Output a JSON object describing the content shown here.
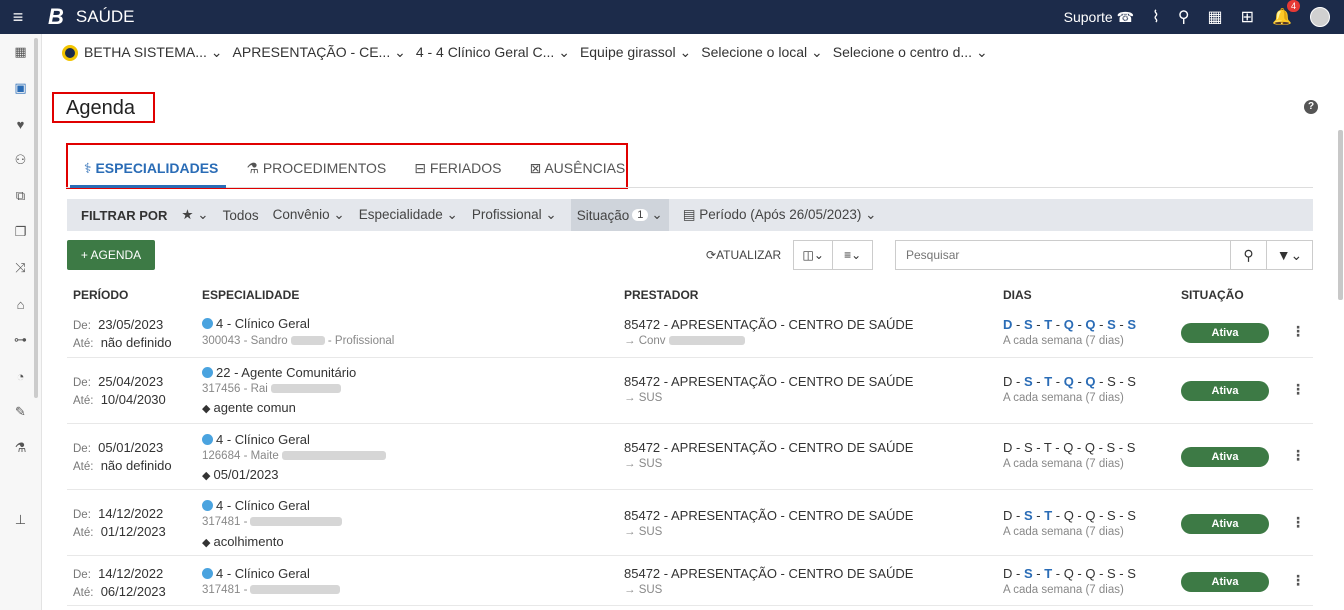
{
  "header": {
    "logo": "B",
    "app_name": "SAÚDE",
    "support_label": "Suporte",
    "notifications_count": "4"
  },
  "breadcrumb": [
    "BETHA SISTEMA... ⌄",
    "APRESENTAÇÃO - CE... ⌄",
    "4 - 4 Clínico Geral C... ⌄",
    "Equipe girassol ⌄",
    "Selecione o local ⌄",
    "Selecione o centro d... ⌄"
  ],
  "page": {
    "title": "Agenda"
  },
  "tabs": [
    {
      "label": "ESPECIALIDADES",
      "icon": "user-md-icon"
    },
    {
      "label": "PROCEDIMENTOS",
      "icon": "flask-icon"
    },
    {
      "label": "FERIADOS",
      "icon": "calendar-minus-icon"
    },
    {
      "label": "AUSÊNCIAS",
      "icon": "calendar-x-icon"
    }
  ],
  "filter": {
    "label": "FILTRAR POR",
    "todos": "Todos",
    "convenio": "Convênio ⌄",
    "especialidade": "Especialidade ⌄",
    "profissional": "Profissional ⌄",
    "situacao": "Situação",
    "situacao_count": "1",
    "periodo": "Período (Após 26/05/2023) ⌄"
  },
  "toolbar": {
    "add_label": "+ AGENDA",
    "refresh_label": "ATUALIZAR",
    "search_placeholder": "Pesquisar"
  },
  "columns": {
    "periodo": "PERÍODO",
    "especialidade": "ESPECIALIDADE",
    "prestador": "PRESTADOR",
    "dias": "DIAS",
    "situacao": "SITUAÇÃO"
  },
  "rows": [
    {
      "de": "23/05/2023",
      "ate": "não definido",
      "esp": "4 - Clínico Geral",
      "prof": "300043 - Sandro",
      "prof_suffix": " - Profissional",
      "tag": "",
      "prest": "85472 - APRESENTAÇÃO - CENTRO DE SAÚDE",
      "prest_sub": "→ Conv",
      "freq": "A cada semana (7 dias)",
      "status": "Ativa"
    },
    {
      "de": "25/04/2023",
      "ate": "10/04/2030",
      "esp": "22 - Agente Comunitário",
      "prof": "317456 - Rai",
      "prof_suffix": "",
      "tag": "agente comun",
      "prest": "85472 - APRESENTAÇÃO - CENTRO DE SAÚDE",
      "prest_sub": "→ SUS",
      "freq": "A cada semana (7 dias)",
      "status": "Ativa"
    },
    {
      "de": "05/01/2023",
      "ate": "não definido",
      "esp": "4 - Clínico Geral",
      "prof": "126684 - Maite",
      "prof_suffix": "",
      "tag": "05/01/2023",
      "prest": "85472 - APRESENTAÇÃO - CENTRO DE SAÚDE",
      "prest_sub": "→ SUS",
      "freq": "A cada semana (7 dias)",
      "status": "Ativa"
    },
    {
      "de": "14/12/2022",
      "ate": "01/12/2023",
      "esp": "4 - Clínico Geral",
      "prof": "317481 -",
      "prof_suffix": "",
      "tag": "acolhimento",
      "prest": "85472 - APRESENTAÇÃO - CENTRO DE SAÚDE",
      "prest_sub": "→ SUS",
      "freq": "A cada semana (7 dias)",
      "status": "Ativa"
    },
    {
      "de": "14/12/2022",
      "ate": "06/12/2023",
      "esp": "4 - Clínico Geral",
      "prof": "317481 -",
      "prof_suffix": "",
      "tag": "",
      "prest": "85472 - APRESENTAÇÃO - CENTRO DE SAÚDE",
      "prest_sub": "→ SUS",
      "freq": "A cada semana (7 dias)",
      "status": "Ativa"
    }
  ],
  "labels": {
    "de": "De:",
    "ate": "Até:"
  },
  "colors": {
    "primary": "#1c2b4a",
    "accent": "#2a6cb6",
    "success": "#3d7a45",
    "highlight": "#e00000"
  }
}
